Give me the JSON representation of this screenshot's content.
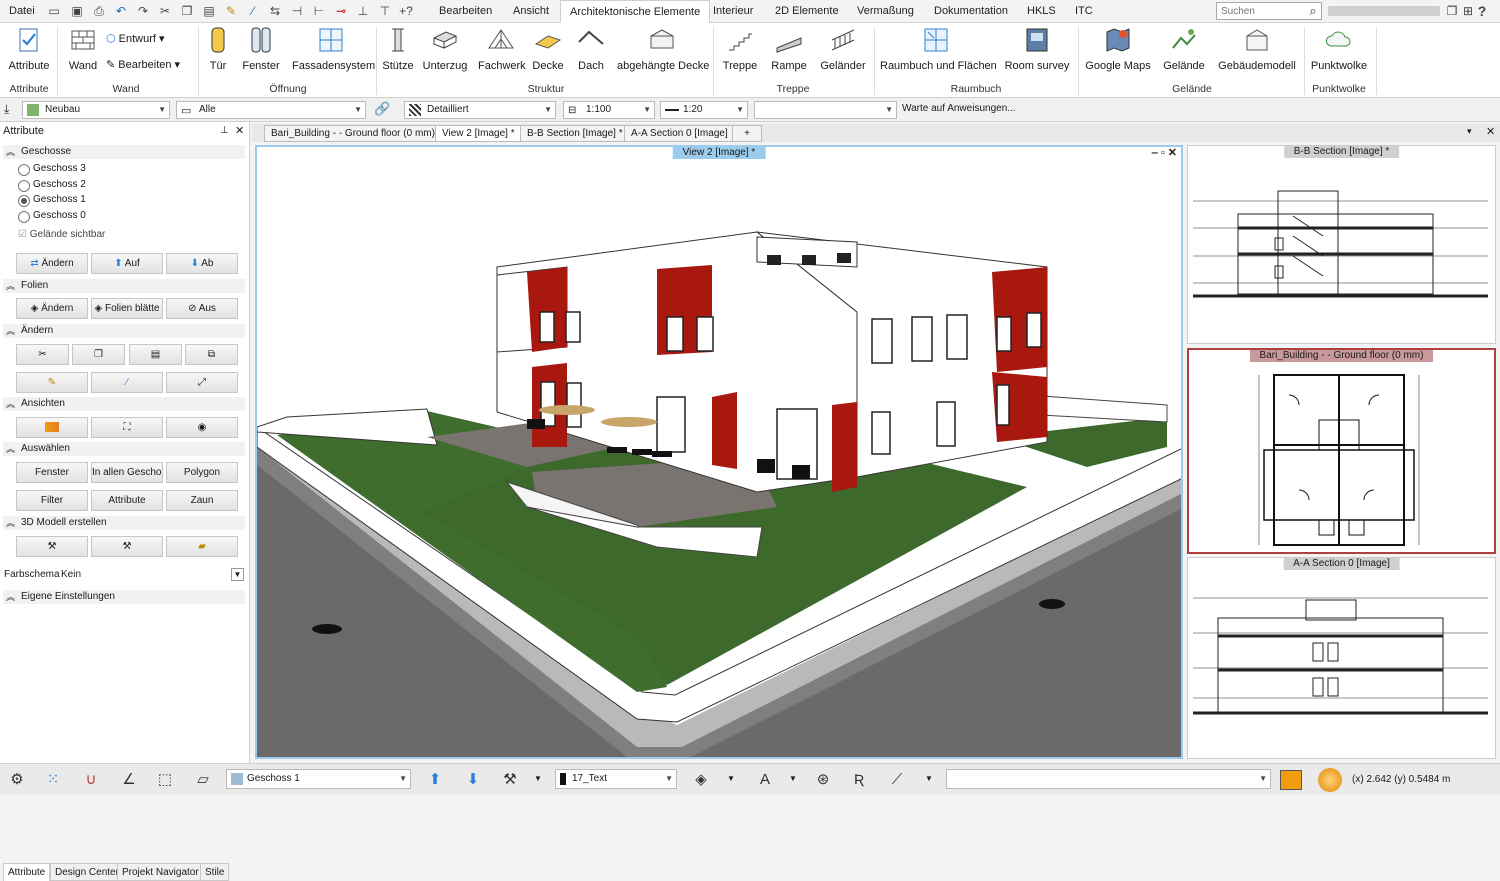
{
  "menu": {
    "file": "Datei",
    "tabs": [
      "Bearbeiten",
      "Ansicht",
      "Architektonische Elemente",
      "Interieur",
      "2D Elemente",
      "Vermaßung",
      "Dokumentation",
      "HKLS",
      "ITC"
    ],
    "search_placeholder": "Suchen",
    "help": "?"
  },
  "ribbon": {
    "buttons": [
      "Attribute",
      "Wand",
      "Tür",
      "Fenster",
      "Fassadensystem",
      "Stütze",
      "Unterzug",
      "Fachwerk",
      "Decke",
      "Dach",
      "abgehängte Decke",
      "Treppe",
      "Rampe",
      "Geländer",
      "Raumbuch und Flächen",
      "Room survey",
      "Google Maps",
      "Gelände",
      "Gebäudemodell",
      "Punktwolke"
    ],
    "small_buttons": {
      "entwurf": "Entwurf",
      "bearbeiten": "Bearbeiten"
    },
    "groups": [
      "Attribute",
      "Wand",
      "Öffnung",
      "Struktur",
      "Treppe",
      "Raumbuch",
      "Gelände",
      "Punktwolke"
    ]
  },
  "propbar": {
    "layer": "Neubau",
    "filter": "Alle",
    "detail": "Detailliert",
    "scale": "1:100",
    "pen": "1:20",
    "prompt": "Warte auf Anweisungen..."
  },
  "leftpanel": {
    "title": "Attribute",
    "sections": {
      "geschosse": "Geschosse",
      "folien": "Folien",
      "aendern": "Ändern",
      "ansichten": "Ansichten",
      "auswaehlen": "Auswählen",
      "modell3d": "3D Modell erstellen",
      "eigene": "Eigene Einstellungen"
    },
    "floors": [
      "Geschoss 3",
      "Geschoss 2",
      "Geschoss 1",
      "Geschoss 0"
    ],
    "terrain_visible": "Gelände sichtbar",
    "floor_buttons": [
      "Ändern",
      "Auf",
      "Ab"
    ],
    "layer_buttons": [
      "Ändern",
      "Folien blätte",
      "Aus"
    ],
    "select_buttons": [
      "Fenster",
      "In allen Geschoss",
      "Polygon",
      "Filter",
      "Attribute",
      "Zaun"
    ],
    "color_scheme_label": "Farbschema",
    "color_scheme_value": "Kein",
    "bottom_tabs": [
      "Attribute",
      "Design Center",
      "Projekt Navigator",
      "Stile"
    ]
  },
  "doctabs": [
    "Bari_Building -  - Ground floor (0 mm)",
    "View 2 [Image] *",
    "B-B Section [Image] *",
    "A-A Section 0 [Image]",
    "+"
  ],
  "views": {
    "main": "View 2 [Image] *",
    "bb": "B-B Section [Image] *",
    "plan": "Bari_Building -  - Ground floor (0 mm)",
    "aa": "A-A Section 0 [Image]"
  },
  "status": {
    "floor": "Geschoss 1",
    "text_style": "17_Text",
    "coords": "(x) 2.642   (y) 0.5484 m"
  },
  "colors": {
    "accent": "#9ccbee",
    "red_wall": "#a8180f",
    "lawn": "#3c6a2c",
    "road": "#666666"
  }
}
